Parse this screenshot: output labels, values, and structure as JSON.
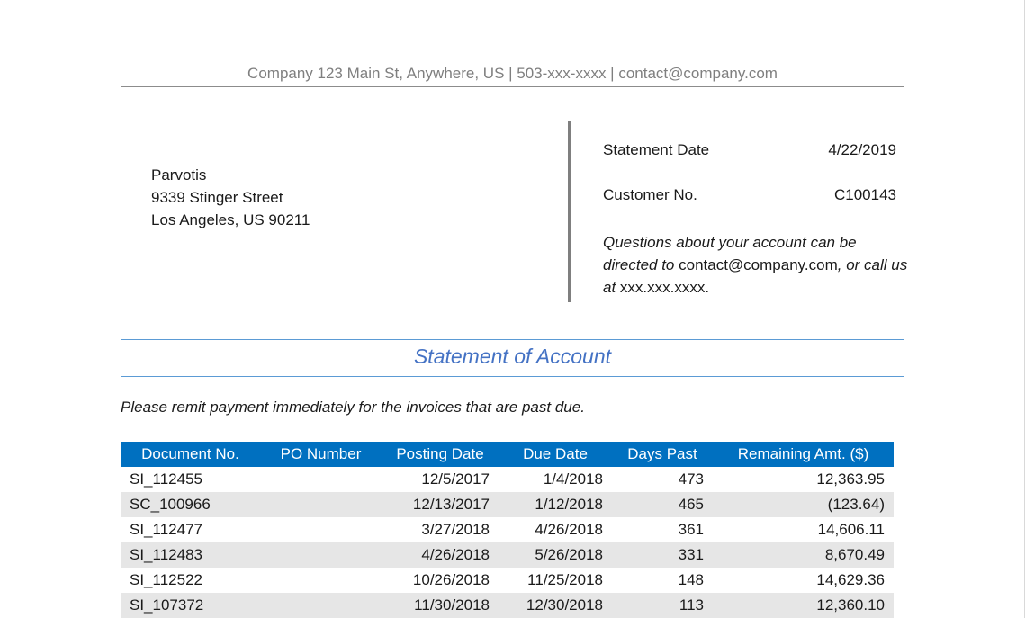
{
  "header": {
    "company_line": "Company 123 Main St, Anywhere, US | 503-xxx-xxxx | contact@company.com"
  },
  "customer_address": {
    "name": "Parvotis",
    "street": "9339 Stinger Street",
    "city_line": "Los Angeles, US 90211"
  },
  "statement_info": {
    "date_label": "Statement Date",
    "date_value": "4/22/2019",
    "customer_label": "Customer No.",
    "customer_value": "C100143",
    "questions_part1": "Questions about your account can be directed to",
    "questions_email": " contact@company.com",
    "questions_part2": ", or call us at",
    "questions_phone": " xxx.xxx.xxxx."
  },
  "title": "Statement of Account",
  "remit_notice": "Please remit payment immediately for the invoices that are past due.",
  "table": {
    "columns": [
      "Document No.",
      "PO Number",
      "Posting Date",
      "Due Date",
      "Days Past",
      "Remaining Amt. ($)"
    ],
    "rows": [
      {
        "doc": "SI_112455",
        "po": "",
        "posting": "12/5/2017",
        "due": "1/4/2018",
        "days": "473",
        "amount": "12,363.95"
      },
      {
        "doc": "SC_100966",
        "po": "",
        "posting": "12/13/2017",
        "due": "1/12/2018",
        "days": "465",
        "amount": "(123.64)"
      },
      {
        "doc": "SI_112477",
        "po": "",
        "posting": "3/27/2018",
        "due": "4/26/2018",
        "days": "361",
        "amount": "14,606.11"
      },
      {
        "doc": "SI_112483",
        "po": "",
        "posting": "4/26/2018",
        "due": "5/26/2018",
        "days": "331",
        "amount": "8,670.49"
      },
      {
        "doc": "SI_112522",
        "po": "",
        "posting": "10/26/2018",
        "due": "11/25/2018",
        "days": "148",
        "amount": "14,629.36"
      },
      {
        "doc": "SI_107372",
        "po": "",
        "posting": "11/30/2018",
        "due": "12/30/2018",
        "days": "113",
        "amount": "12,360.10"
      }
    ]
  }
}
